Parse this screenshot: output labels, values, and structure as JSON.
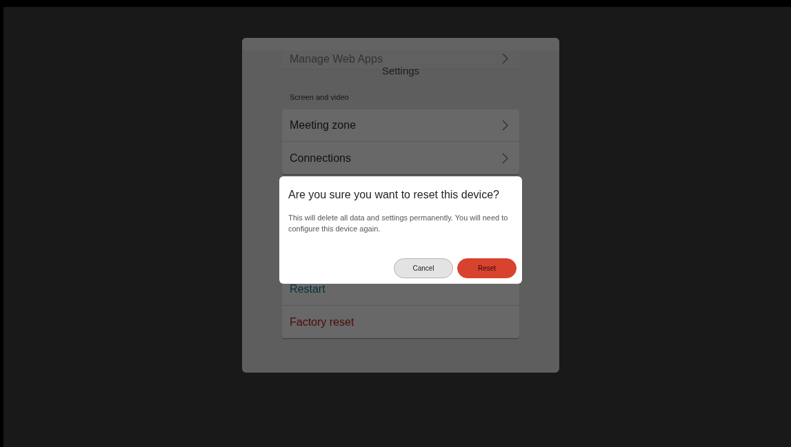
{
  "settings": {
    "title": "Settings",
    "scrolled_row": {
      "label": "Manage Web Apps",
      "kind": "nav"
    },
    "section_header": "Screen and video",
    "groups": [
      {
        "rows": [
          {
            "label": "Meeting zone",
            "kind": "nav"
          },
          {
            "label": "Connections",
            "kind": "nav"
          }
        ]
      },
      {
        "rows": [
          {
            "label": "Restart",
            "kind": "action"
          },
          {
            "label": "Factory reset",
            "kind": "danger"
          }
        ]
      }
    ]
  },
  "dialog": {
    "title": "Are you sure you want to reset this device?",
    "message": "This will delete all data and settings permanently. You will need to configure this device again.",
    "buttons": [
      {
        "label": "Cancel",
        "kind": "secondary"
      },
      {
        "label": "Reset",
        "kind": "destructive"
      }
    ]
  }
}
